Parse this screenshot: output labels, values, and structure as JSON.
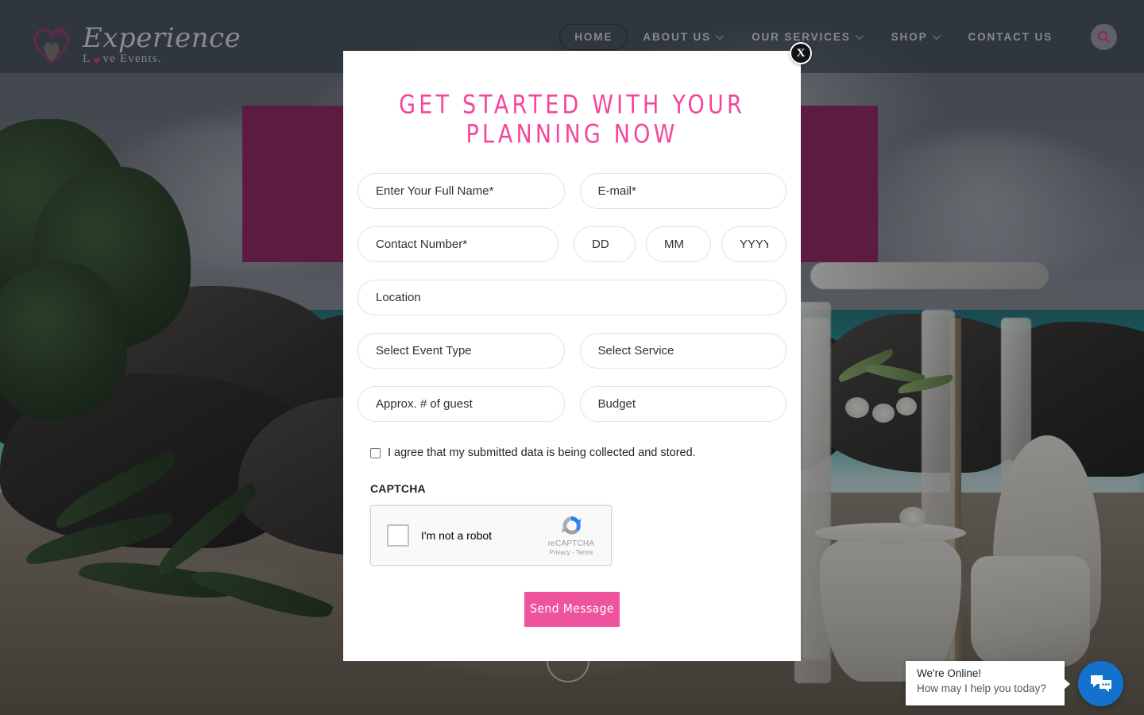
{
  "header": {
    "logo": {
      "title": "Experience",
      "subtitle_before": "",
      "subtitle_after": "ve Events.",
      "subtitle_full": "Love Events.",
      "mark_icon": "heart-rings-icon"
    },
    "nav": [
      {
        "label": "HOME",
        "has_caret": false,
        "active": true,
        "name": "nav-home"
      },
      {
        "label": "ABOUT US",
        "has_caret": true,
        "active": false,
        "name": "nav-about-us"
      },
      {
        "label": "OUR SERVICES",
        "has_caret": true,
        "active": false,
        "name": "nav-our-services"
      },
      {
        "label": "SHOP",
        "has_caret": true,
        "active": false,
        "name": "nav-shop"
      },
      {
        "label": "CONTACT US",
        "has_caret": false,
        "active": false,
        "name": "nav-contact-us"
      }
    ],
    "search_icon": "search-icon"
  },
  "modal": {
    "close_label": "X",
    "title": "Get Started With Your Planning Now",
    "fields": {
      "full_name": {
        "placeholder": "Enter Your Full Name*",
        "value": ""
      },
      "email": {
        "placeholder": "E-mail*",
        "value": ""
      },
      "contact_number": {
        "placeholder": "Contact Number*",
        "value": ""
      },
      "day": {
        "placeholder": "DD",
        "value": ""
      },
      "month": {
        "placeholder": "MM",
        "value": ""
      },
      "year": {
        "placeholder": "YYYY",
        "value": ""
      },
      "location": {
        "placeholder": "Location",
        "value": ""
      },
      "event_type": {
        "selected": "Select Event Type"
      },
      "service": {
        "selected": "Select Service"
      },
      "guests": {
        "placeholder": "Approx. # of guest",
        "value": ""
      },
      "budget": {
        "placeholder": "Budget",
        "value": ""
      }
    },
    "consent": {
      "label": "I agree that my submitted data is being collected and stored.",
      "checked": false
    },
    "captcha": {
      "section_label": "CAPTCHA",
      "checkbox_label": "I'm not a robot",
      "brand": "reCAPTCHA",
      "links": "Privacy - Terms",
      "logo_icon": "recaptcha-logo-icon"
    },
    "submit_label": "Send Message"
  },
  "chat": {
    "title": "We're Online!",
    "subtitle": "How may I help you today?",
    "fab_icon": "chat-bubbles-icon"
  },
  "colors": {
    "accent_pink": "#f0539d",
    "title_pink": "#f5459c",
    "brand_maroon": "#7d1e53",
    "chat_blue": "#1372cd",
    "header_overlay": "rgba(42,48,56,0.72)"
  }
}
